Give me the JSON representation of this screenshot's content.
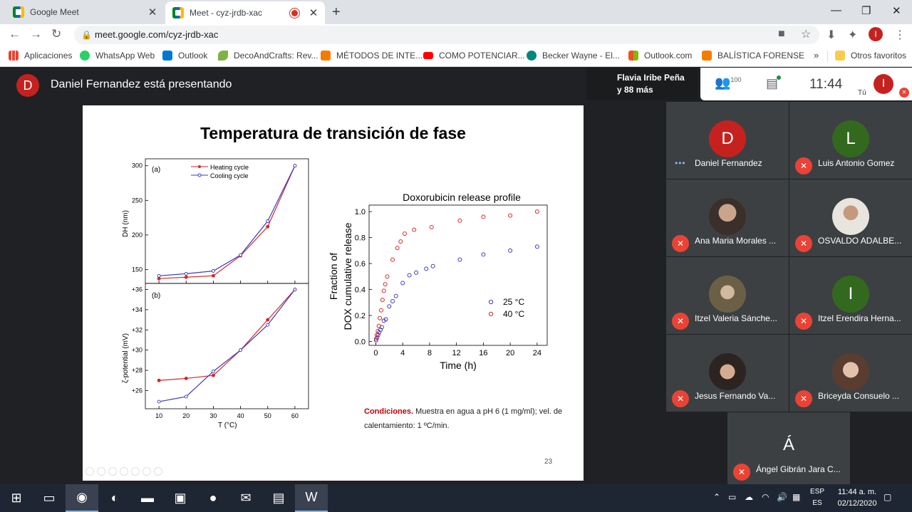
{
  "browser": {
    "tabs": [
      {
        "title": "Google Meet"
      },
      {
        "title": "Meet - cyz-jrdb-xac"
      }
    ],
    "url": "meet.google.com/cyz-jrdb-xac",
    "profile_initial": "I",
    "bookmarks": [
      {
        "label": "Aplicaciones",
        "color": "#ea4335"
      },
      {
        "label": "WhatsApp Web",
        "color": "#25d366"
      },
      {
        "label": "Outlook",
        "color": "#0078d4"
      },
      {
        "label": "DecoAndCrafts: Rev...",
        "color": "#7cb342"
      },
      {
        "label": "MÉTODOS DE INTE...",
        "color": "#f57c00"
      },
      {
        "label": "COMO POTENCIAR...",
        "color": "#ff0000"
      },
      {
        "label": "Becker Wayne - El...",
        "color": "#00897b"
      },
      {
        "label": "Outlook.com",
        "color": "#f25022"
      },
      {
        "label": "BALÍSTICA FORENSE",
        "color": "#f57c00"
      }
    ],
    "bookmarks_more": "»",
    "other_favorites": "Otros favoritos"
  },
  "meet": {
    "presenter_initial": "D",
    "presenting_text": "Daniel Fernandez está presentando",
    "presenting_users": [
      "Flavia Iribe Peña",
      "y 88 más"
    ],
    "participant_count": "100",
    "time": "11:44",
    "you_label": "Tú",
    "you_initial": "I",
    "participants": [
      {
        "name": "Daniel Fernandez",
        "initial": "D",
        "color": "#c5221f",
        "speaking": true
      },
      {
        "name": "Luis Antonio Gomez",
        "initial": "L",
        "color": "#33691e",
        "speaking": false
      },
      {
        "name": "Ana Maria Morales ...",
        "initial": "",
        "color": "#6b5a4a",
        "speaking": false
      },
      {
        "name": "OSVALDO ADALBE...",
        "initial": "",
        "color": "#d8d3cc",
        "speaking": false
      },
      {
        "name": "Itzel Valeria Sánche...",
        "initial": "",
        "color": "#7a6a55",
        "speaking": false
      },
      {
        "name": "Itzel Erendira Herna...",
        "initial": "I",
        "color": "#33691e",
        "speaking": false
      },
      {
        "name": "Jesus Fernando Va...",
        "initial": "",
        "color": "#8a7060",
        "speaking": false
      },
      {
        "name": "Briceyda Consuelo ...",
        "initial": "",
        "color": "#b08a78",
        "speaking": false
      },
      {
        "name": "Ángel Gibrán Jara C...",
        "initial": "Á",
        "color": "#00796b",
        "speaking": false
      }
    ]
  },
  "slide": {
    "title": "Temperatura de transición de fase",
    "conditions_label": "Condiciones.",
    "conditions_text": " Muestra en agua a pH 6 (1 mg/ml); vel. de calentamiento: 1 ºC/min.",
    "page_number": "23"
  },
  "taskbar": {
    "lang": [
      "ESP",
      "ES"
    ],
    "time": "11:44 a. m.",
    "date": "02/12/2020"
  },
  "chart_data": [
    {
      "type": "line",
      "panel": "(a)",
      "x": [
        10,
        20,
        30,
        40,
        50,
        60
      ],
      "xlim": [
        5,
        65
      ],
      "ylim": [
        130,
        310
      ],
      "yticks": [
        150,
        200,
        250,
        300
      ],
      "ylabel": "DH (nm)",
      "series": [
        {
          "name": "Heating cycle",
          "color": "#d62728",
          "marker": "filled",
          "values": [
            137,
            139,
            141,
            170,
            212,
            300
          ]
        },
        {
          "name": "Cooling cycle",
          "color": "#3b3bb8",
          "marker": "open",
          "values": [
            141,
            144,
            148,
            171,
            220,
            300
          ]
        }
      ],
      "legend": "top-left"
    },
    {
      "type": "line",
      "panel": "(b)",
      "x": [
        10,
        20,
        30,
        40,
        50,
        60
      ],
      "xlim": [
        5,
        65
      ],
      "ylim": [
        24.2,
        36.6
      ],
      "yticks": [
        "+26",
        "+28",
        "+30",
        "+32",
        "+34",
        "+36"
      ],
      "ylabel": "ζ-potential (mV)",
      "xlabel": "T (°C)",
      "series": [
        {
          "name": "Heating cycle",
          "color": "#d62728",
          "marker": "filled",
          "values": [
            27.0,
            27.2,
            27.5,
            30.0,
            33.0,
            36.0
          ]
        },
        {
          "name": "Cooling cycle",
          "color": "#3b3bb8",
          "marker": "open",
          "values": [
            24.9,
            25.4,
            27.9,
            30.0,
            32.5,
            36.0
          ]
        }
      ]
    },
    {
      "type": "scatter",
      "title": "Doxorubicin release profile",
      "xlabel": "Time (h)",
      "ylabel": "Fraction of DOX cumulative release",
      "xlim": [
        -1,
        25.5
      ],
      "ylim": [
        -0.03,
        1.05
      ],
      "xticks": [
        0,
        4,
        8,
        12,
        16,
        20,
        24
      ],
      "yticks": [
        "0.0",
        "0.2",
        "0.4",
        "0.6",
        "0.8",
        "1.0"
      ],
      "legend": "bottom-right",
      "series": [
        {
          "name": "25 °C",
          "color": "#3b3bb8",
          "points": [
            [
              0.05,
              0.01
            ],
            [
              0.2,
              0.03
            ],
            [
              0.35,
              0.05
            ],
            [
              0.5,
              0.07
            ],
            [
              0.7,
              0.09
            ],
            [
              0.9,
              0.11
            ],
            [
              1.2,
              0.16
            ],
            [
              1.5,
              0.17
            ],
            [
              2.0,
              0.27
            ],
            [
              2.5,
              0.31
            ],
            [
              3.0,
              0.35
            ],
            [
              4.0,
              0.45
            ],
            [
              5.0,
              0.51
            ],
            [
              6.0,
              0.53
            ],
            [
              7.5,
              0.56
            ],
            [
              8.5,
              0.58
            ],
            [
              12.5,
              0.63
            ],
            [
              16.0,
              0.67
            ],
            [
              20.0,
              0.7
            ],
            [
              24.0,
              0.73
            ]
          ]
        },
        {
          "name": "40 °C",
          "color": "#d62728",
          "points": [
            [
              0.05,
              0.02
            ],
            [
              0.15,
              0.05
            ],
            [
              0.3,
              0.08
            ],
            [
              0.45,
              0.12
            ],
            [
              0.6,
              0.18
            ],
            [
              0.8,
              0.24
            ],
            [
              1.0,
              0.32
            ],
            [
              1.2,
              0.39
            ],
            [
              1.4,
              0.44
            ],
            [
              1.7,
              0.5
            ],
            [
              2.5,
              0.63
            ],
            [
              3.2,
              0.72
            ],
            [
              3.7,
              0.77
            ],
            [
              4.3,
              0.83
            ],
            [
              5.7,
              0.86
            ],
            [
              8.3,
              0.88
            ],
            [
              12.5,
              0.93
            ],
            [
              16.0,
              0.96
            ],
            [
              20.0,
              0.97
            ],
            [
              24.0,
              1.0
            ]
          ]
        }
      ]
    }
  ]
}
